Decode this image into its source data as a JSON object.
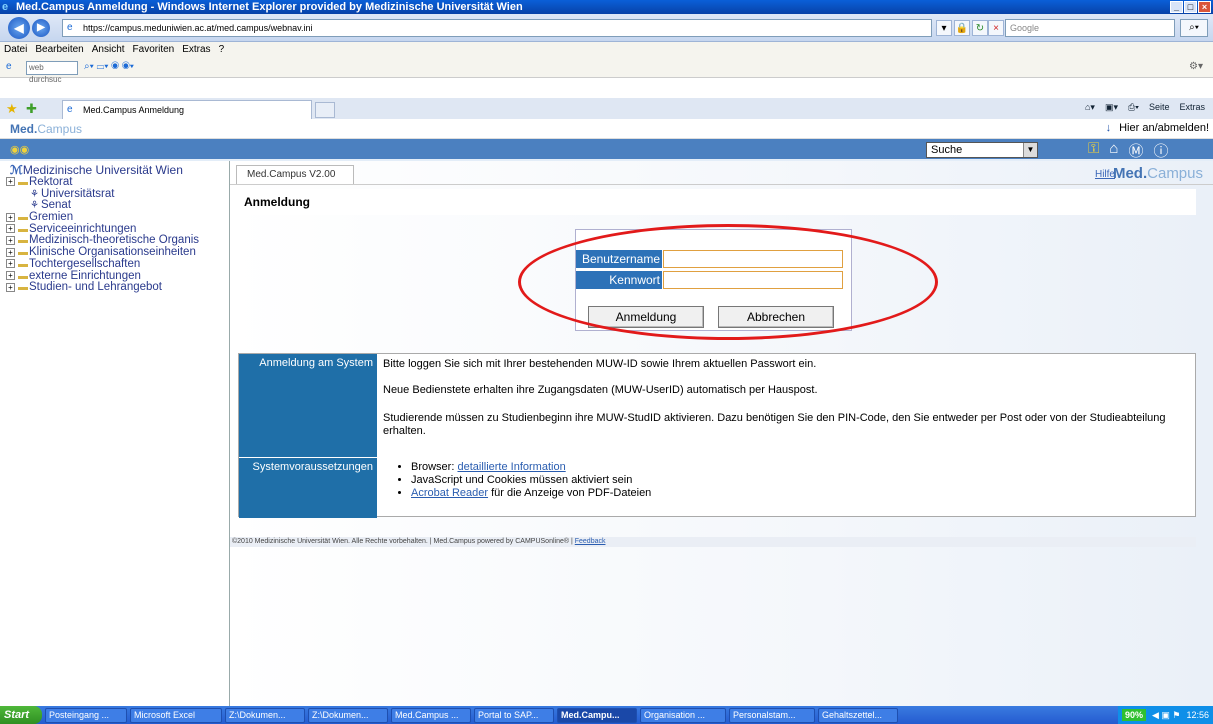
{
  "window": {
    "title": "Med.Campus Anmeldung - Windows Internet Explorer provided by Medizinische Universität Wien"
  },
  "browser": {
    "url": "https://campus.meduniwien.ac.at/med.campus/webnav.ini",
    "search_placeholder": "Google",
    "menu": [
      "Datei",
      "Bearbeiten",
      "Ansicht",
      "Favoriten",
      "Extras",
      "?"
    ],
    "web_search_placeholder": "web durchsuc",
    "tab_title": "Med.Campus Anmeldung",
    "command_items": [
      "Seite",
      "Extras"
    ]
  },
  "app": {
    "logo_main": "Med.",
    "logo_sub": "Campus",
    "login_link": "Hier an/abmelden!",
    "search_select": "Suche",
    "help": "Hilfe",
    "version_tab": "Med.Campus V2.00",
    "page_heading": "Anmeldung"
  },
  "sidebar": {
    "root": "Medizinische Universität Wien",
    "items": [
      {
        "label": "Rektorat",
        "type": "folder"
      },
      {
        "label": "Universitätsrat",
        "type": "sub"
      },
      {
        "label": "Senat",
        "type": "sub"
      },
      {
        "label": "Gremien",
        "type": "folder"
      },
      {
        "label": "Serviceeinrichtungen",
        "type": "folder"
      },
      {
        "label": "Medizinisch-theoretische Organis",
        "type": "folder"
      },
      {
        "label": "Klinische Organisationseinheiten",
        "type": "folder"
      },
      {
        "label": "Tochtergesellschaften",
        "type": "folder"
      },
      {
        "label": "externe Einrichtungen",
        "type": "folder"
      },
      {
        "label": "Studien- und Lehrangebot",
        "type": "folder"
      }
    ]
  },
  "login": {
    "username_label": "Benutzername",
    "password_label": "Kennwort",
    "username_value": "",
    "password_value": "",
    "submit": "Anmeldung",
    "cancel": "Abbrechen"
  },
  "info": {
    "system_label": "Anmeldung am System",
    "line1": "Bitte loggen Sie sich mit Ihrer bestehenden MUW-ID sowie Ihrem aktuellen Passwort ein.",
    "line2": "Neue Bedienstete erhalten ihre Zugangsdaten (MUW-UserID) automatisch per Hauspost.",
    "line3": "Studierende müssen zu Studienbeginn ihre MUW-StudID aktivieren. Dazu benötigen Sie den PIN-Code, den Sie entweder per Post oder von der Studieabteilung erhalten.",
    "req_label": "Systemvoraussetzungen",
    "req1_prefix": "Browser: ",
    "req1_link": "detaillierte Information",
    "req2": "JavaScript und Cookies müssen aktiviert sein",
    "req3_link": "Acrobat Reader",
    "req3_suffix": " für die Anzeige von PDF-Dateien"
  },
  "footer": {
    "text": "©2010 Medizinische Universität Wien. Alle Rechte vorbehalten. | Med.Campus powered by CAMPUSonline® | ",
    "link": "Feedback"
  },
  "taskbar": {
    "start": "Start",
    "items": [
      {
        "label": "Posteingang ...",
        "active": false
      },
      {
        "label": "Microsoft Excel",
        "active": false
      },
      {
        "label": "Z:\\Dokumen...",
        "active": false
      },
      {
        "label": "Z:\\Dokumen...",
        "active": false
      },
      {
        "label": "Med.Campus ...",
        "active": false
      },
      {
        "label": "Portal to SAP...",
        "active": false
      },
      {
        "label": "Med.Campu...",
        "active": true
      },
      {
        "label": "Organisation ...",
        "active": false
      },
      {
        "label": "Personalstam...",
        "active": false
      },
      {
        "label": "Gehaltszettel...",
        "active": false
      }
    ],
    "zoom": "90%",
    "clock": "12:56"
  }
}
